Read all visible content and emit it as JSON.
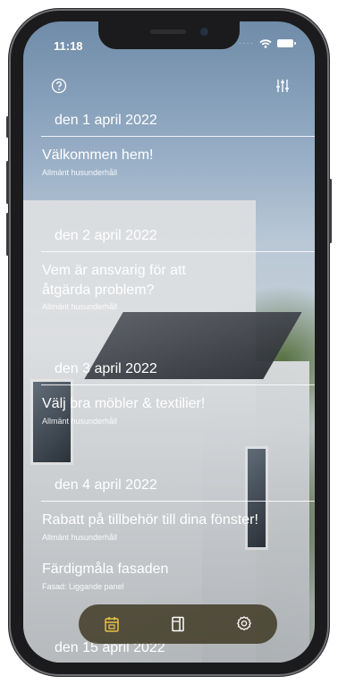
{
  "status_bar": {
    "time": "11:18"
  },
  "top_icons": {
    "help": "help-circle-icon",
    "filter": "sliders-icon"
  },
  "entries": [
    {
      "date": "den 1 april 2022",
      "items": [
        {
          "title": "Välkommen hem!",
          "category": "Allmänt husunderhåll"
        }
      ]
    },
    {
      "date": "den 2 april 2022",
      "items": [
        {
          "title_line1": "Vem är ansvarig för att",
          "title_line2": "åtgärda problem?",
          "category": "Allmänt husunderhåll"
        }
      ]
    },
    {
      "date": "den 3 april 2022",
      "items": [
        {
          "title": "Välj bra möbler & textilier!",
          "category": "Allmänt husunderhåll"
        }
      ]
    },
    {
      "date": "den 4 april 2022",
      "items": [
        {
          "title": "Rabatt på tillbehör till dina fönster!",
          "category": "Allmänt husunderhåll"
        },
        {
          "title": "Färdigmåla fasaden",
          "category": "Fasad: Liggande panel"
        }
      ]
    },
    {
      "date": "den 15 april 2022",
      "items": []
    }
  ],
  "tab_bar": {
    "tabs": [
      "calendar-icon",
      "notebook-icon",
      "settings-icon"
    ],
    "active": "calendar-icon",
    "accent_color": "#e8c24a"
  }
}
